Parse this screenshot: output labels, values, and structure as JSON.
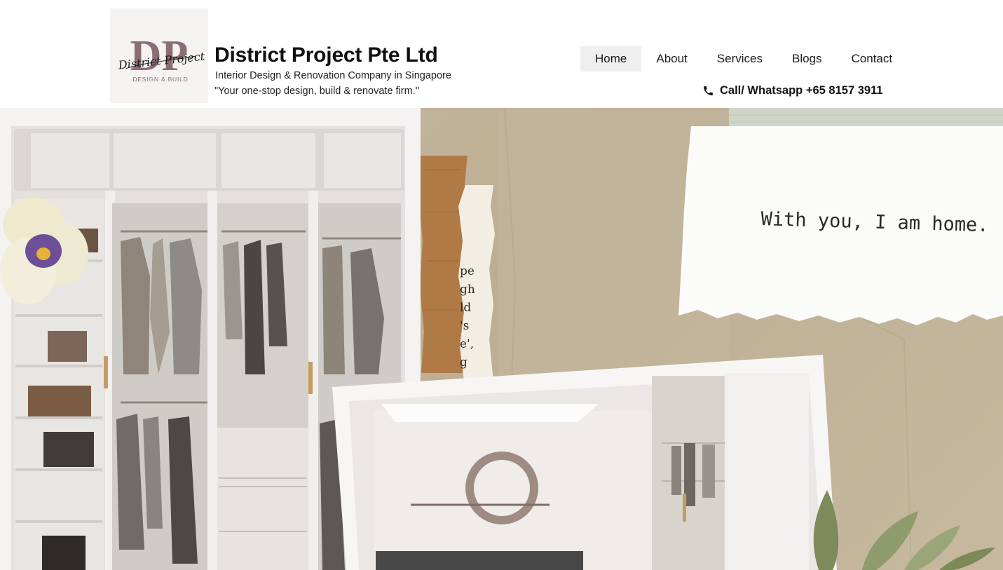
{
  "brand": {
    "logo_letters": "DP",
    "logo_script": "District Project",
    "logo_caption": "DESIGN & BUILD",
    "title": "District Project Pte Ltd",
    "subtitle": "Interior Design & Renovation Company in Singapore",
    "tagline": "\"Your one-stop design, build & renovate firm.\""
  },
  "nav": {
    "items": [
      {
        "label": "Home"
      },
      {
        "label": "About"
      },
      {
        "label": "Services"
      },
      {
        "label": "Blogs"
      },
      {
        "label": "Contact"
      }
    ],
    "active": "Home"
  },
  "contact": {
    "call_label": "Call/ Whatsapp +65 8157 3911",
    "icon": "phone-icon"
  },
  "hero": {
    "note_text": "With you, I am home.",
    "book_fragment": [
      "pe",
      "gh",
      "ld",
      "'s",
      "e',",
      "g"
    ]
  },
  "colors": {
    "accent_nav_bg": "#efefef",
    "logo_mauve": "#8a6d75",
    "hero_bg": "#c2b59c"
  }
}
